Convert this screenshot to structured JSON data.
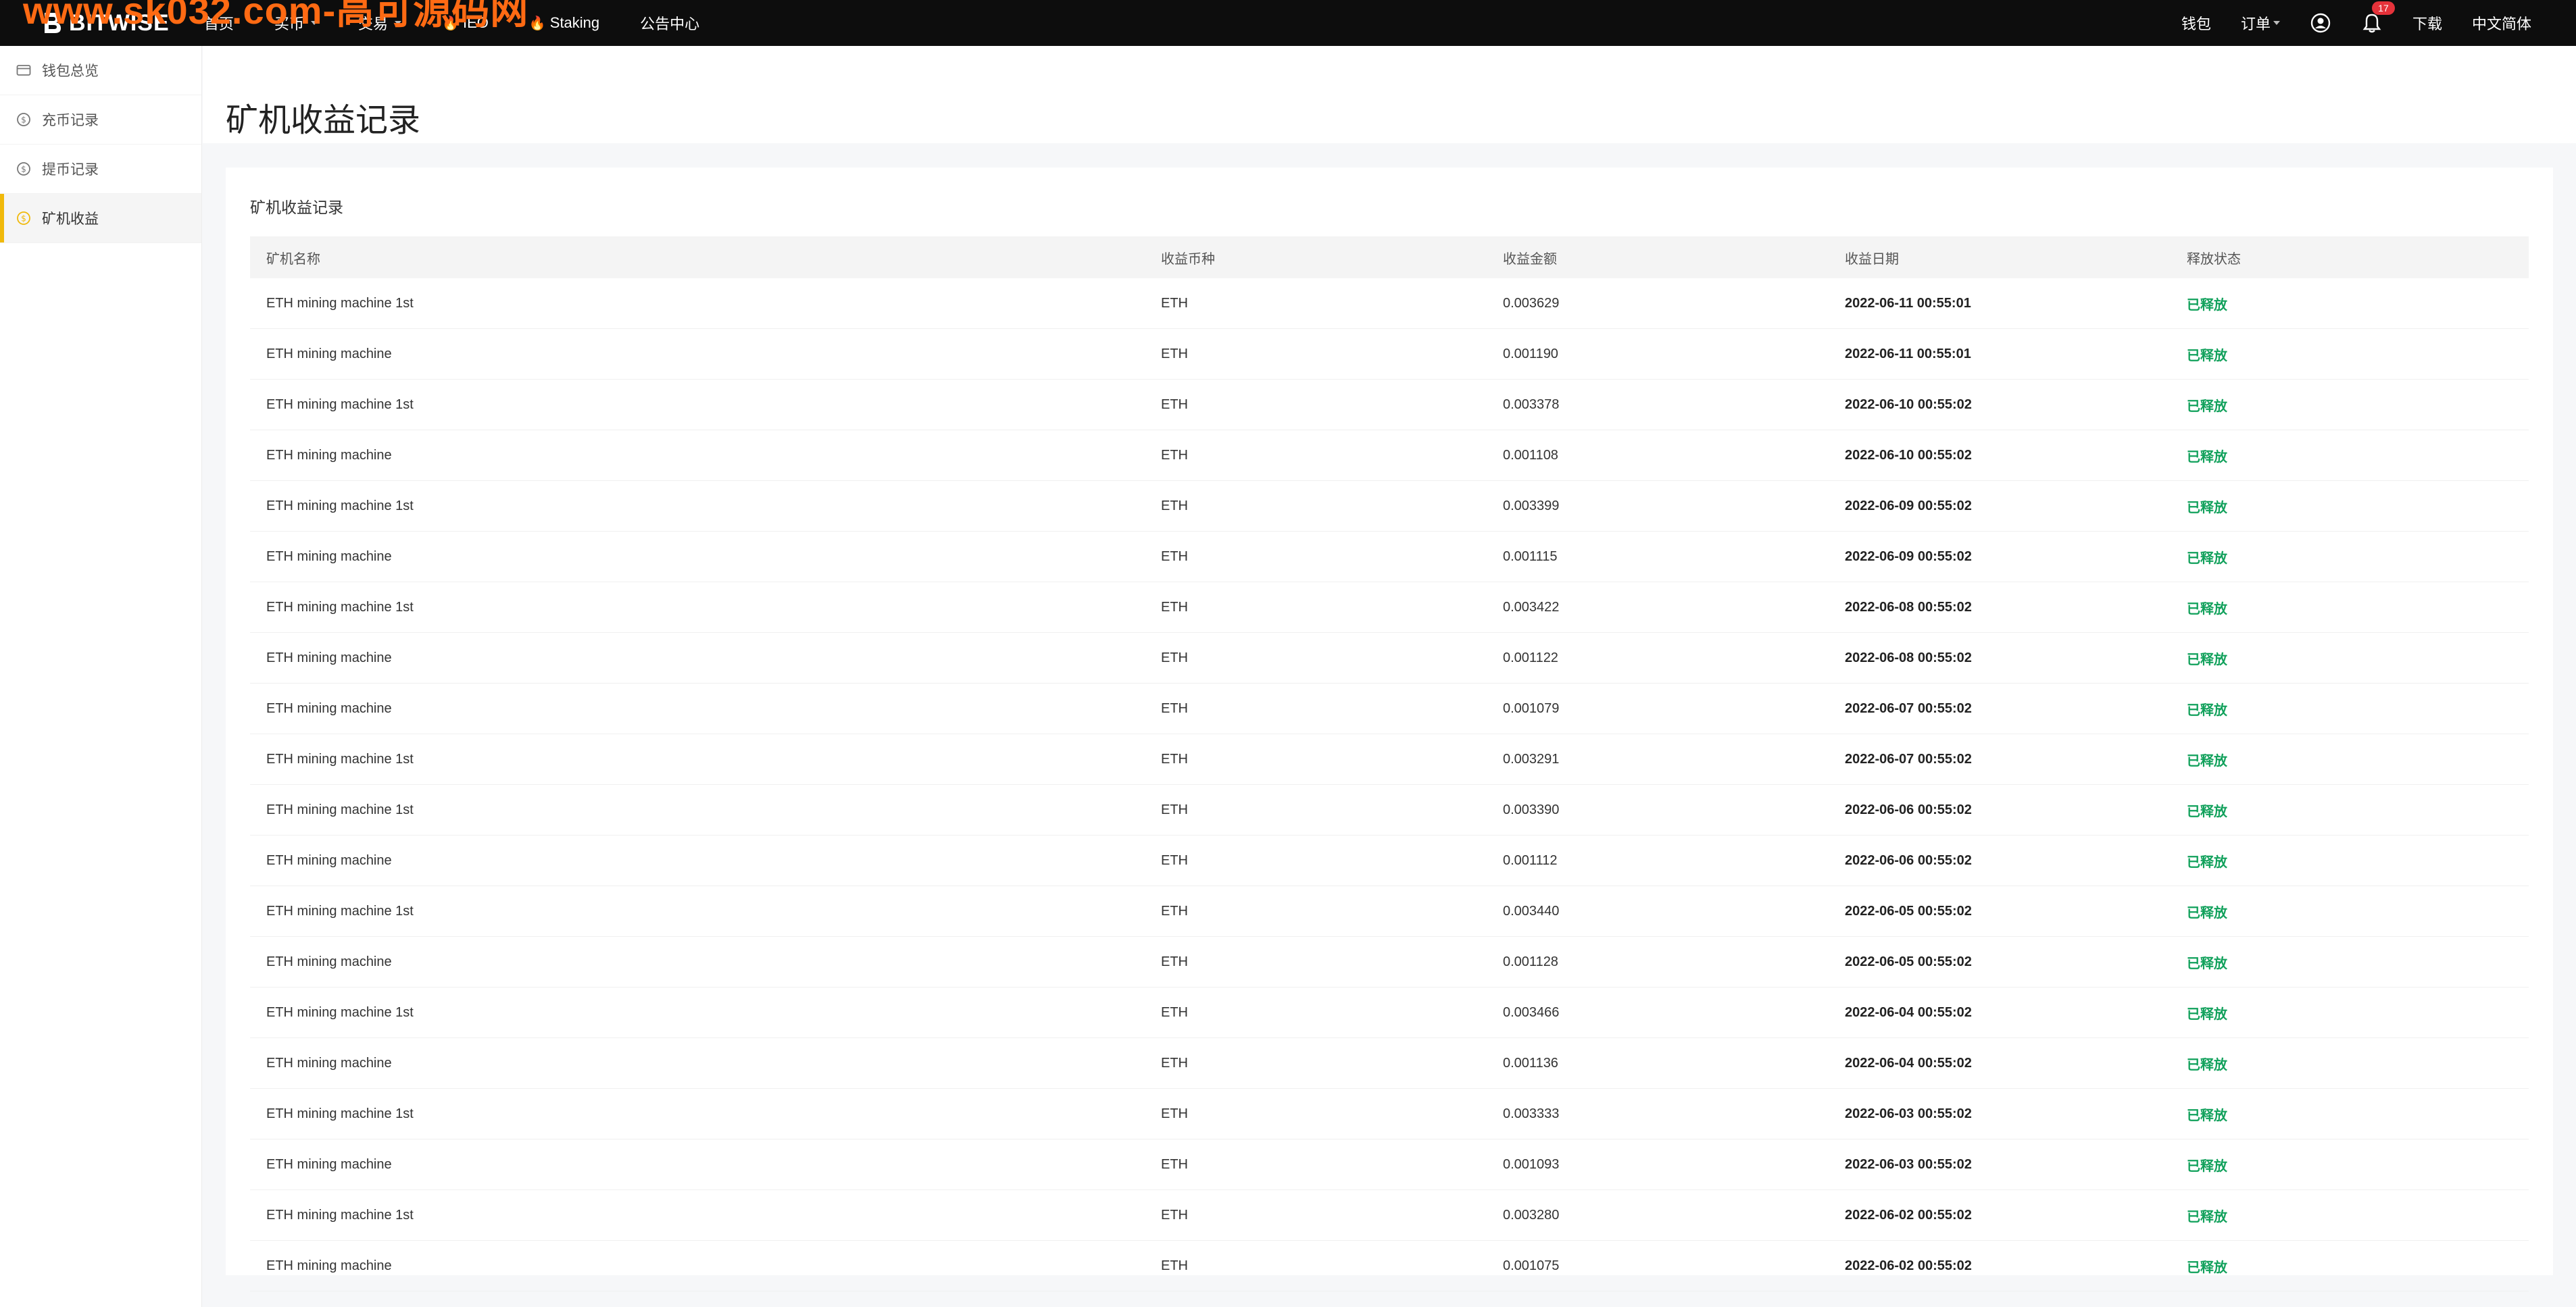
{
  "watermark": "www.sk032.com-高可源码网",
  "brand": {
    "name": "BITWISE"
  },
  "nav": {
    "left": [
      {
        "label": "首页",
        "dropdown": false,
        "hot": false
      },
      {
        "label": "买币",
        "dropdown": true,
        "hot": false
      },
      {
        "label": "交易",
        "dropdown": true,
        "hot": false
      },
      {
        "label": "IEO",
        "dropdown": false,
        "hot": true
      },
      {
        "label": "Staking",
        "dropdown": false,
        "hot": true
      },
      {
        "label": "公告中心",
        "dropdown": false,
        "hot": false
      }
    ],
    "wallet": "钱包",
    "orders": "订单",
    "notification_count": "17",
    "download": "下载",
    "language": "中文简体"
  },
  "sidebar": {
    "items": [
      {
        "label": "钱包总览",
        "icon": "wallet-icon",
        "active": false
      },
      {
        "label": "充币记录",
        "icon": "dollar-circle-icon",
        "active": false
      },
      {
        "label": "提币记录",
        "icon": "dollar-circle-icon",
        "active": false
      },
      {
        "label": "矿机收益",
        "icon": "dollar-circle-icon",
        "active": true
      }
    ]
  },
  "page": {
    "title": "矿机收益记录"
  },
  "card": {
    "title": "矿机收益记录"
  },
  "table": {
    "headers": [
      "矿机名称",
      "收益币种",
      "收益金额",
      "收益日期",
      "释放状态"
    ],
    "rows": [
      [
        "ETH mining machine 1st",
        "ETH",
        "0.003629",
        "2022-06-11 00:55:01",
        "已释放"
      ],
      [
        "ETH mining machine",
        "ETH",
        "0.001190",
        "2022-06-11 00:55:01",
        "已释放"
      ],
      [
        "ETH mining machine 1st",
        "ETH",
        "0.003378",
        "2022-06-10 00:55:02",
        "已释放"
      ],
      [
        "ETH mining machine",
        "ETH",
        "0.001108",
        "2022-06-10 00:55:02",
        "已释放"
      ],
      [
        "ETH mining machine 1st",
        "ETH",
        "0.003399",
        "2022-06-09 00:55:02",
        "已释放"
      ],
      [
        "ETH mining machine",
        "ETH",
        "0.001115",
        "2022-06-09 00:55:02",
        "已释放"
      ],
      [
        "ETH mining machine 1st",
        "ETH",
        "0.003422",
        "2022-06-08 00:55:02",
        "已释放"
      ],
      [
        "ETH mining machine",
        "ETH",
        "0.001122",
        "2022-06-08 00:55:02",
        "已释放"
      ],
      [
        "ETH mining machine",
        "ETH",
        "0.001079",
        "2022-06-07 00:55:02",
        "已释放"
      ],
      [
        "ETH mining machine 1st",
        "ETH",
        "0.003291",
        "2022-06-07 00:55:02",
        "已释放"
      ],
      [
        "ETH mining machine 1st",
        "ETH",
        "0.003390",
        "2022-06-06 00:55:02",
        "已释放"
      ],
      [
        "ETH mining machine",
        "ETH",
        "0.001112",
        "2022-06-06 00:55:02",
        "已释放"
      ],
      [
        "ETH mining machine 1st",
        "ETH",
        "0.003440",
        "2022-06-05 00:55:02",
        "已释放"
      ],
      [
        "ETH mining machine",
        "ETH",
        "0.001128",
        "2022-06-05 00:55:02",
        "已释放"
      ],
      [
        "ETH mining machine 1st",
        "ETH",
        "0.003466",
        "2022-06-04 00:55:02",
        "已释放"
      ],
      [
        "ETH mining machine",
        "ETH",
        "0.001136",
        "2022-06-04 00:55:02",
        "已释放"
      ],
      [
        "ETH mining machine 1st",
        "ETH",
        "0.003333",
        "2022-06-03 00:55:02",
        "已释放"
      ],
      [
        "ETH mining machine",
        "ETH",
        "0.001093",
        "2022-06-03 00:55:02",
        "已释放"
      ],
      [
        "ETH mining machine 1st",
        "ETH",
        "0.003280",
        "2022-06-02 00:55:02",
        "已释放"
      ],
      [
        "ETH mining machine",
        "ETH",
        "0.001075",
        "2022-06-02 00:55:02",
        "已释放"
      ]
    ]
  },
  "colors": {
    "topbar": "#0d0d0d",
    "accent": "#f0b90b",
    "status_released": "#12a15c",
    "badge": "#e5323a",
    "watermark": "#ff6a13"
  }
}
